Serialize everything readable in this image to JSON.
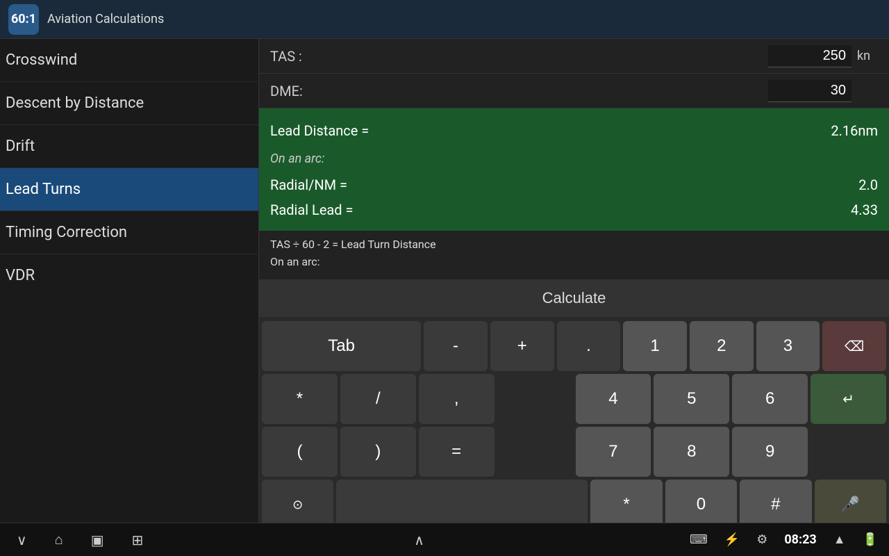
{
  "app": {
    "icon_label": "60:1",
    "title": "Aviation Calculations"
  },
  "sidebar": {
    "items": [
      {
        "id": "crosswind",
        "label": "Crosswind",
        "active": false
      },
      {
        "id": "descent",
        "label": "Descent by Distance",
        "active": false
      },
      {
        "id": "drift",
        "label": "Drift",
        "active": false
      },
      {
        "id": "lead-turns",
        "label": "Lead Turns",
        "active": true
      },
      {
        "id": "timing",
        "label": "Timing Correction",
        "active": false
      },
      {
        "id": "vdr-partial",
        "label": "VDR",
        "active": false
      }
    ]
  },
  "calculator": {
    "tas_label": "TAS :",
    "tas_value": "250",
    "tas_unit": "kn",
    "dme_label": "DME:",
    "dme_value": "30",
    "lead_distance_label": "Lead Distance =",
    "lead_distance_value": "2.16nm",
    "on_an_arc_label": "On an arc:",
    "radial_nm_label": "Radial/NM =",
    "radial_nm_value": "2.0",
    "radial_lead_label": "Radial Lead =",
    "radial_lead_value": "4.33",
    "formula_text": "TAS ÷ 60 - 2 = Lead Turn Distance",
    "on_an_arc_label2": "On an arc:",
    "calculate_button": "Calculate"
  },
  "keyboard": {
    "row1": [
      "Tab",
      "-",
      "+",
      ".",
      "1",
      "2",
      "3",
      "⌫"
    ],
    "row2": [
      "*",
      "/",
      ",",
      "",
      "4",
      "5",
      "6",
      "↵"
    ],
    "row3": [
      "(",
      ")",
      "=",
      "",
      "7",
      "8",
      "9",
      ""
    ],
    "row4": [
      "⊙",
      "",
      "",
      "",
      "*",
      "0",
      "#",
      "🎤"
    ]
  },
  "system": {
    "back": "∨",
    "home": "⌂",
    "recent": "▣",
    "screenshot": "⊞",
    "chevron": "∧",
    "keyboard_icon": "⌨",
    "usb_icon": "⚡",
    "settings_icon": "⚙",
    "time": "08:23",
    "network_icon": "▲",
    "battery_icon": "🔋"
  }
}
